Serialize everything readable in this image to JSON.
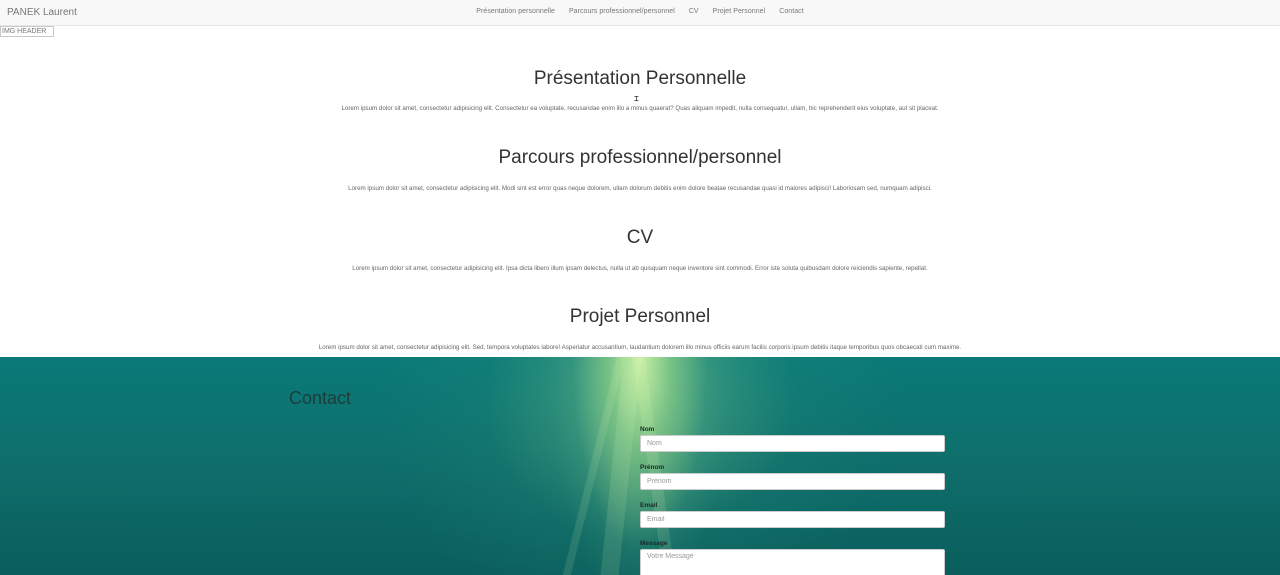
{
  "navbar": {
    "brand": "PANEK Laurent",
    "links": [
      {
        "label": "Présentation personnelle"
      },
      {
        "label": "Parcours professionnel/personnel"
      },
      {
        "label": "CV"
      },
      {
        "label": "Projet Personnel"
      },
      {
        "label": "Contact"
      }
    ]
  },
  "header": {
    "image_alt": "IMG HEADER"
  },
  "sections": [
    {
      "title": "Présentation Personnelle",
      "text": "Lorem ipsum dolor sit amet, consectetur adipisicing elit. Consectetur ea voluptate, recusandae enim illo a minus quaerat? Quas aliquam impedit, nulla consequatur, ullam, hic reprehenderit eius voluptate, aut sit placeat."
    },
    {
      "title": "Parcours professionnel/personnel",
      "text": "Lorem ipsum dolor sit amet, consectetur adipisicing elit. Modi sint est error quas neque dolorem, ullam dolorum debitis enim dolore beatae recusandae quasi id maiores adipisci! Laboriosam sed, numquam adipisci."
    },
    {
      "title": "CV",
      "text": "Lorem ipsum dolor sit amet, consectetur adipisicing elit. Ipsa dicta libero illum ipsam delectus, nulla ut ab quisquam neque inventore sint commodi. Error iste soluta quibusdam dolore reiciendis sapiente, repellat."
    },
    {
      "title": "Projet Personnel",
      "text": "Lorem ipsum dolor sit amet, consectetur adipisicing elit. Sed, tempora voluptates labore! Asperiatur accusantium, laudantium dolorem illo minus officiis earum facilis corporis ipsum debitis itaque temporibus quos obcaecati cum maxime."
    }
  ],
  "contact": {
    "title": "Contact",
    "fields": {
      "nom": {
        "label": "Nom",
        "placeholder": "Nom"
      },
      "prenom": {
        "label": "Prénom",
        "placeholder": "Prénom"
      },
      "email": {
        "label": "Email",
        "placeholder": "Email"
      },
      "message": {
        "label": "Message",
        "placeholder": "Votre Message"
      }
    }
  },
  "colors": {
    "navbar_bg": "#f8f8f8",
    "contact_bg": "#0a7a78",
    "light_ray": "#e1ffaa"
  }
}
